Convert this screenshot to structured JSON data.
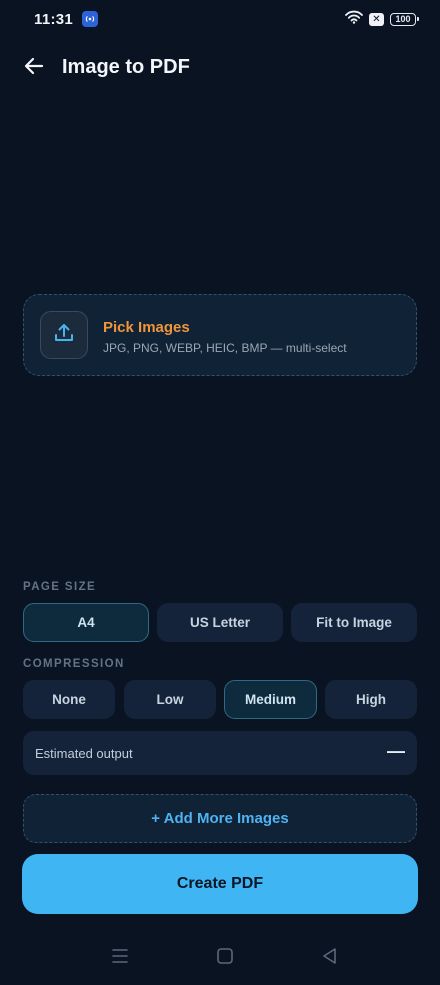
{
  "status_bar": {
    "time": "11:31",
    "x_badge": "✕",
    "battery": "100"
  },
  "app_bar": {
    "title": "Image to PDF"
  },
  "picker": {
    "title": "Pick Images",
    "subtitle": "JPG, PNG, WEBP, HEIC, BMP — multi-select"
  },
  "page_size": {
    "label": "PAGE SIZE",
    "options": [
      "A4",
      "US Letter",
      "Fit to Image"
    ],
    "selected": "A4"
  },
  "compression": {
    "label": "COMPRESSION",
    "options": [
      "None",
      "Low",
      "Medium",
      "High"
    ],
    "selected": "Medium"
  },
  "estimate": {
    "label": "Estimated output",
    "value": "—"
  },
  "actions": {
    "add_more": "+ Add More Images",
    "create_pdf": "Create PDF"
  },
  "colors": {
    "background": "#0a1322",
    "accent": "#3fb5f4",
    "pick_title": "#f0953a",
    "card": "#15233a"
  },
  "icons": {
    "back": "arrow-left-icon",
    "upload": "upload-icon",
    "cast": "cast-icon",
    "wifi": "wifi-icon",
    "nav_recents": "menu-icon",
    "nav_home": "square-icon",
    "nav_back": "triangle-back-icon"
  }
}
